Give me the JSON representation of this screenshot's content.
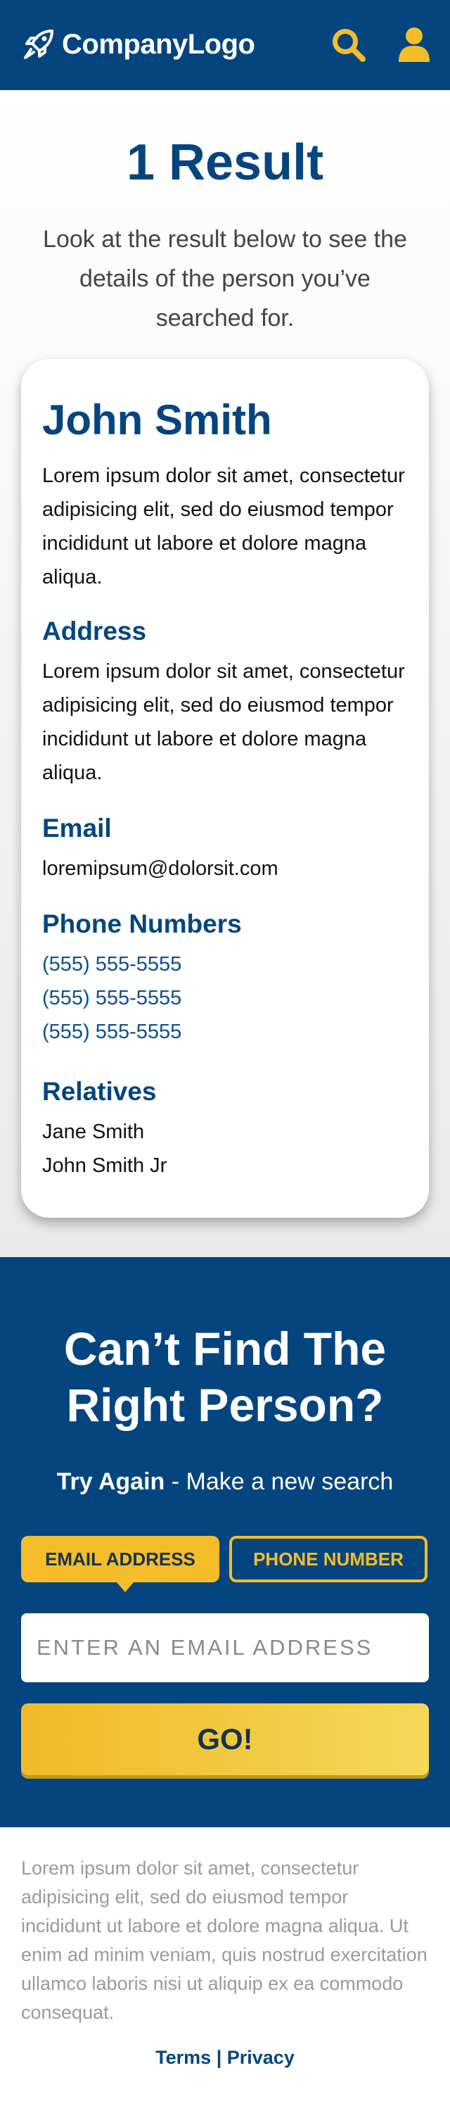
{
  "header": {
    "logo_text": "CompanyLogo",
    "logo_icon": "rocket-icon",
    "search_icon": "search-icon",
    "user_icon": "user-icon",
    "colors": {
      "background": "#04457f",
      "accent": "#f5bd2a"
    }
  },
  "results": {
    "title": "1 Result",
    "description": "Look at the result below to see the details of the person you’ve searched for.",
    "card": {
      "name": "John Smith",
      "intro": "Lorem ipsum dolor sit amet, consectetur adipisicing elit, sed do eiusmod tempor incididunt ut labore et dolore magna aliqua.",
      "address_heading": "Address",
      "address_text": "Lorem ipsum dolor sit amet, consectetur adipisicing elit, sed do eiusmod tempor incididunt ut labore et dolore magna aliqua.",
      "email_heading": "Email",
      "email_value": "loremipsum@dolorsit.com",
      "phones_heading": "Phone Numbers",
      "phones": [
        "(555) 555-5555",
        "(555) 555-5555",
        "(555) 555-5555"
      ],
      "relatives_heading": "Relatives",
      "relatives": [
        "Jane Smith",
        "John Smith Jr"
      ]
    }
  },
  "search": {
    "title": "Can’t Find The Right Person?",
    "subtitle_bold": "Try Again",
    "subtitle_rest": " - Make a new search",
    "tabs": [
      {
        "label": "EMAIL ADDRESS",
        "active": true
      },
      {
        "label": "PHONE NUMBER",
        "active": false
      }
    ],
    "input_placeholder": "ENTER AN EMAIL ADDRESS",
    "input_value": "",
    "go_label": "GO!"
  },
  "footer": {
    "text": "Lorem ipsum dolor sit amet, consectetur adipisicing elit, sed do eiusmod tempor incididunt ut labore et dolore magna aliqua. Ut enim ad minim veniam, quis nostrud exercitation ullamco laboris nisi ut aliquip ex ea commodo consequat.",
    "terms_label": "Terms",
    "separator": " | ",
    "privacy_label": "Privacy"
  }
}
